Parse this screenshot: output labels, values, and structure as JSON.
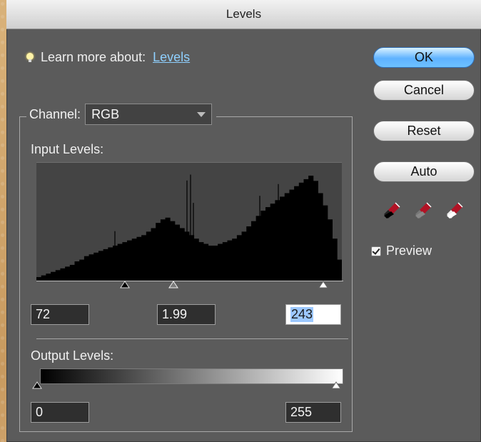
{
  "window": {
    "title": "Levels"
  },
  "learn": {
    "prefix": "Learn more about:",
    "link": "Levels"
  },
  "buttons": {
    "ok": "OK",
    "cancel": "Cancel",
    "reset": "Reset",
    "auto": "Auto"
  },
  "preview": {
    "label": "Preview",
    "checked": true
  },
  "channel": {
    "label": "Channel:",
    "value": "RGB"
  },
  "input_levels": {
    "label": "Input Levels:",
    "black": "72",
    "gamma": "1.99",
    "white": "243",
    "histogram": {
      "type": "histogram",
      "bins": 64,
      "heights": [
        2,
        3,
        4,
        5,
        6,
        7,
        8,
        9,
        11,
        12,
        14,
        15,
        16,
        17,
        18,
        19,
        20,
        21,
        22,
        23,
        24,
        25,
        26,
        28,
        30,
        33,
        35,
        36,
        34,
        32,
        30,
        28,
        26,
        24,
        22,
        21,
        20,
        20,
        21,
        22,
        23,
        24,
        26,
        28,
        31,
        34,
        37,
        40,
        42,
        44,
        46,
        48,
        50,
        52,
        54,
        56,
        58,
        60,
        57,
        50,
        43,
        35,
        24,
        12
      ]
    }
  },
  "output_levels": {
    "label": "Output Levels:",
    "black": "0",
    "white": "255"
  }
}
